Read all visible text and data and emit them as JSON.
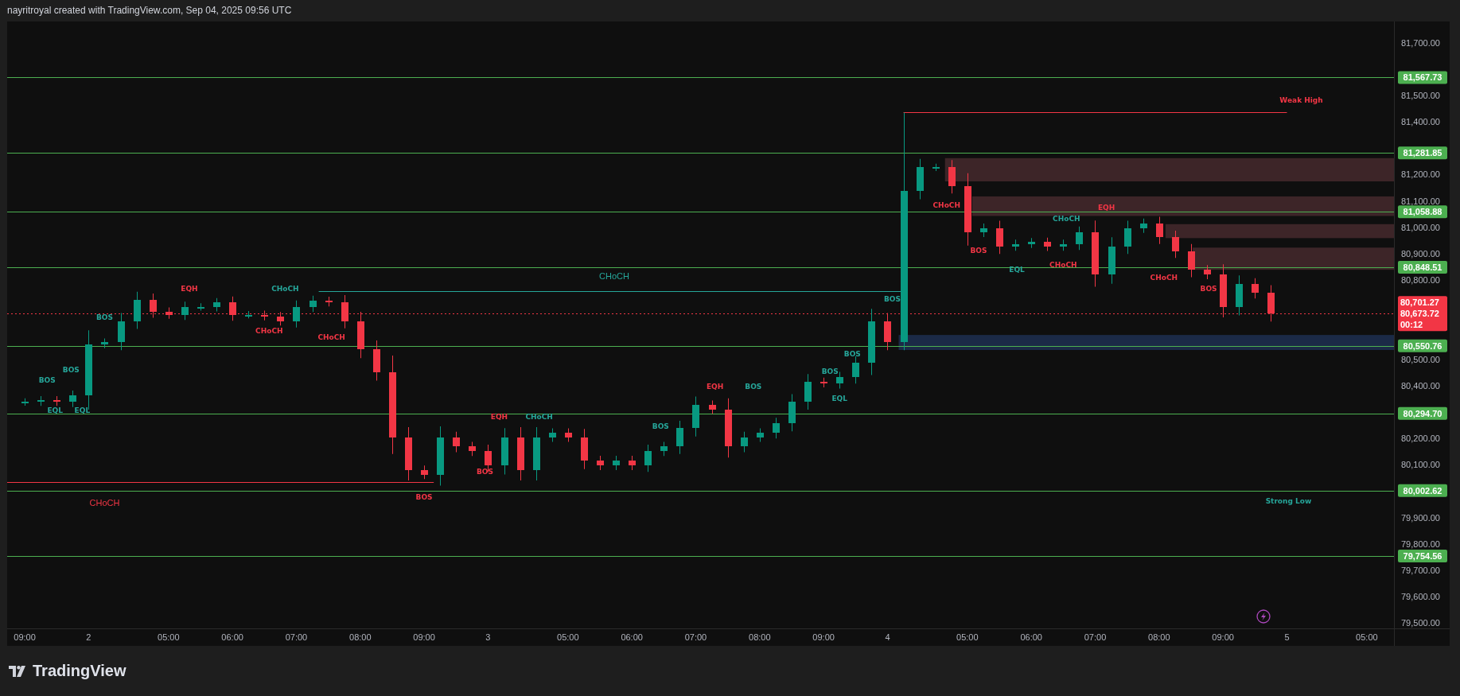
{
  "header": {
    "text": "nayritroyal created with TradingView.com, Sep 04, 2025 09:56 UTC"
  },
  "chart": {
    "chart_data": {
      "type": "candlestick",
      "categories": [
        "09:00",
        null,
        null,
        null,
        "2",
        null,
        null,
        null,
        null,
        "05:00",
        null,
        null,
        null,
        "06:00",
        null,
        null,
        null,
        "07:00",
        null,
        null,
        null,
        "08:00",
        null,
        null,
        null,
        "09:00",
        null,
        null,
        null,
        "3",
        null,
        null,
        null,
        null,
        "05:00",
        null,
        null,
        null,
        "06:00",
        null,
        null,
        null,
        "07:00",
        null,
        null,
        null,
        "08:00",
        null,
        null,
        null,
        "09:00",
        null,
        null,
        null,
        "4",
        null,
        null,
        null,
        null,
        "05:00",
        null,
        null,
        null,
        "06:00",
        null,
        null,
        null,
        "07:00",
        null,
        null,
        null,
        "08:00",
        null,
        null,
        null,
        "09:00",
        null,
        null,
        null,
        "5",
        null,
        null,
        null,
        null,
        "05:00"
      ],
      "ohlc": [
        [
          80338,
          80352,
          80324,
          80338
        ],
        [
          80338,
          80360,
          80323,
          80345
        ],
        [
          80345,
          80360,
          80323,
          80338
        ],
        [
          80338,
          80381,
          80319,
          80362
        ],
        [
          80362,
          80610,
          80309,
          80557
        ],
        [
          80557,
          80579,
          80542,
          80564
        ],
        [
          80564,
          80675,
          80534,
          80645
        ],
        [
          80645,
          80756,
          80615,
          80726
        ],
        [
          80726,
          80749,
          80657,
          80680
        ],
        [
          80680,
          80696,
          80653,
          80669
        ],
        [
          80669,
          80718,
          80649,
          80698
        ],
        [
          80698,
          80712,
          80684,
          80698
        ],
        [
          80698,
          80732,
          80681,
          80715
        ],
        [
          80715,
          80738,
          80646,
          80669
        ],
        [
          80669,
          80683,
          80655,
          80669
        ],
        [
          80669,
          80684,
          80647,
          80662
        ],
        [
          80662,
          80679,
          80628,
          80645
        ],
        [
          80645,
          80723,
          80620,
          80698
        ],
        [
          80698,
          80741,
          80679,
          80722
        ],
        [
          80722,
          80737,
          80700,
          80715
        ],
        [
          80715,
          80743,
          80617,
          80645
        ],
        [
          80645,
          80680,
          80504,
          80539
        ],
        [
          80539,
          80571,
          80419,
          80451
        ],
        [
          80451,
          80514,
          80141,
          80204
        ],
        [
          80204,
          80243,
          80041,
          80080
        ],
        [
          80080,
          80097,
          80046,
          80063
        ],
        [
          80063,
          80246,
          80021,
          80204
        ],
        [
          80204,
          80225,
          80148,
          80169
        ],
        [
          80169,
          80187,
          80133,
          80151
        ],
        [
          80151,
          80176,
          80073,
          80098
        ],
        [
          80098,
          80239,
          80063,
          80204
        ],
        [
          80204,
          80243,
          80041,
          80080
        ],
        [
          80080,
          80243,
          80041,
          80204
        ],
        [
          80204,
          80238,
          80187,
          80221
        ],
        [
          80221,
          80238,
          80187,
          80204
        ],
        [
          80204,
          80236,
          80084,
          80116
        ],
        [
          80116,
          80134,
          80080,
          80098
        ],
        [
          80098,
          80134,
          80080,
          80116
        ],
        [
          80116,
          80134,
          80080,
          80098
        ],
        [
          80098,
          80176,
          80073,
          80151
        ],
        [
          80151,
          80187,
          80133,
          80169
        ],
        [
          80169,
          80267,
          80141,
          80239
        ],
        [
          80239,
          80359,
          80207,
          80327
        ],
        [
          80327,
          80344,
          80293,
          80310
        ],
        [
          80310,
          80352,
          80127,
          80169
        ],
        [
          80169,
          80225,
          80148,
          80204
        ],
        [
          80204,
          80238,
          80187,
          80221
        ],
        [
          80221,
          80278,
          80200,
          80257
        ],
        [
          80257,
          80368,
          80227,
          80338
        ],
        [
          80338,
          80444,
          80309,
          80415
        ],
        [
          80415,
          80430,
          80393,
          80408
        ],
        [
          80408,
          80452,
          80389,
          80433
        ],
        [
          80433,
          80511,
          80408,
          80486
        ],
        [
          80486,
          80691,
          80440,
          80645
        ],
        [
          80645,
          80675,
          80534,
          80564
        ],
        [
          80564,
          81435,
          80534,
          81138
        ],
        [
          81138,
          81259,
          81106,
          81227
        ],
        [
          81227,
          81241,
          81213,
          81227
        ],
        [
          81227,
          81255,
          81128,
          81156
        ],
        [
          81156,
          81205,
          80931,
          80980
        ],
        [
          80980,
          81014,
          80963,
          80997
        ],
        [
          80997,
          81025,
          80899,
          80927
        ],
        [
          80927,
          80953,
          80911,
          80937
        ],
        [
          80937,
          80959,
          80922,
          80944
        ],
        [
          80944,
          80961,
          80910,
          80927
        ],
        [
          80927,
          80953,
          80911,
          80937
        ],
        [
          80937,
          81003,
          80914,
          80980
        ],
        [
          80980,
          81026,
          80775,
          80821
        ],
        [
          80821,
          80962,
          80786,
          80927
        ],
        [
          80927,
          81025,
          80899,
          80997
        ],
        [
          80997,
          81033,
          80979,
          81015
        ],
        [
          81015,
          81040,
          80937,
          80962
        ],
        [
          80962,
          80987,
          80884,
          80909
        ],
        [
          80909,
          80937,
          80811,
          80839
        ],
        [
          80839,
          80857,
          80803,
          80821
        ],
        [
          80821,
          80860,
          80659,
          80698
        ],
        [
          80698,
          80818,
          80666,
          80786
        ],
        [
          80786,
          80807,
          80730,
          80751
        ],
        [
          80751,
          80781,
          80643,
          80673
        ],
        null,
        null,
        null,
        null,
        null,
        null
      ],
      "ylim": [
        79480,
        81780
      ],
      "yticks": [
        {
          "value": 81700,
          "label": "81,700.00"
        },
        {
          "value": 81500,
          "label": "81,500.00"
        },
        {
          "value": 81400,
          "label": "81,400.00"
        },
        {
          "value": 81200,
          "label": "81,200.00"
        },
        {
          "value": 81100,
          "label": "81,100.00"
        },
        {
          "value": 81000,
          "label": "81,000.00"
        },
        {
          "value": 80900,
          "label": "80,900.00"
        },
        {
          "value": 80800,
          "label": "80,800.00"
        },
        {
          "value": 80500,
          "label": "80,500.00"
        },
        {
          "value": 80400,
          "label": "80,400.00"
        },
        {
          "value": 80200,
          "label": "80,200.00"
        },
        {
          "value": 80100,
          "label": "80,100.00"
        },
        {
          "value": 79900,
          "label": "79,900.00"
        },
        {
          "value": 79800,
          "label": "79,800.00"
        },
        {
          "value": 79700,
          "label": "79,700.00"
        },
        {
          "value": 79600,
          "label": "79,600.00"
        },
        {
          "value": 79500,
          "label": "79,500.00"
        }
      ],
      "ref_lines": [
        {
          "axis": "y",
          "value": 81567.73,
          "label": "81,567.73"
        },
        {
          "axis": "y",
          "value": 81281.85,
          "label": "81,281.85"
        },
        {
          "axis": "y",
          "value": 81058.88,
          "label": "81,058.88"
        },
        {
          "axis": "y",
          "value": 80848.51,
          "label": "80,848.51"
        },
        {
          "axis": "y",
          "value": 80550.76,
          "label": "80,550.76"
        },
        {
          "axis": "y",
          "value": 80294.7,
          "label": "80,294.70"
        },
        {
          "axis": "y",
          "value": 80002.62,
          "label": "80,002.62"
        },
        {
          "axis": "y",
          "value": 79754.56,
          "label": "79,754.56"
        },
        {
          "axis": "y",
          "value": 81435
        },
        {
          "axis": "y",
          "value": 80034
        },
        {
          "axis": "y",
          "value": 80757
        },
        {
          "axis": "y",
          "value": 80673.72
        }
      ],
      "bands": [
        {
          "axis": "y",
          "from": 81174,
          "to": 81262
        },
        {
          "axis": "y",
          "from": 81043,
          "to": 81117
        },
        {
          "axis": "y",
          "from": 80959,
          "to": 81012
        },
        {
          "axis": "y",
          "from": 80839,
          "to": 80923
        },
        {
          "axis": "y",
          "from": 80535,
          "to": 80592
        }
      ]
    },
    "ref_line_styles": [
      {
        "color": "#4caf50"
      },
      {
        "color": "#4caf50"
      },
      {
        "color": "#4caf50"
      },
      {
        "color": "#4caf50"
      },
      {
        "color": "#4caf50"
      },
      {
        "color": "#4caf50"
      },
      {
        "color": "#4caf50"
      },
      {
        "color": "#4caf50"
      },
      {
        "color": "#f23645"
      },
      {
        "color": "#f23645"
      },
      {
        "color": "#26a69a"
      },
      {
        "color": "#f23645",
        "kind": "dotted"
      }
    ],
    "band_styles": [
      {
        "color": "#3d2528"
      },
      {
        "color": "#3d2528"
      },
      {
        "color": "#3d2528"
      },
      {
        "color": "#3d2528"
      },
      {
        "color": "#1b2a47"
      }
    ],
    "structure_labels": [
      {
        "text": "BOS",
        "color": "#26a69a"
      },
      {
        "text": "EQL",
        "color": "#26a69a"
      },
      {
        "text": "BOS",
        "color": "#26a69a"
      },
      {
        "text": "EQL",
        "color": "#26a69a"
      },
      {
        "text": "BOS",
        "color": "#26a69a"
      },
      {
        "text": "EQH",
        "color": "#f23645"
      },
      {
        "text": "CHoCH",
        "color": "#26a69a"
      },
      {
        "text": "CHoCH",
        "color": "#f23645"
      },
      {
        "text": "CHoCH",
        "color": "#f23645"
      },
      {
        "text": "BOS",
        "color": "#f23645"
      },
      {
        "text": "CHoCH",
        "color": "#f23645",
        "kind": "major"
      },
      {
        "text": "EQH",
        "color": "#f23645"
      },
      {
        "text": "BOS",
        "color": "#f23645"
      },
      {
        "text": "CHoCH",
        "color": "#26a69a"
      },
      {
        "text": "BOS",
        "color": "#26a69a"
      },
      {
        "text": "EQH",
        "color": "#f23645"
      },
      {
        "text": "BOS",
        "color": "#26a69a"
      },
      {
        "text": "BOS",
        "color": "#26a69a"
      },
      {
        "text": "EQL",
        "color": "#26a69a"
      },
      {
        "text": "BOS",
        "color": "#26a69a"
      },
      {
        "text": "BOS",
        "color": "#26a69a"
      },
      {
        "text": "CHoCH",
        "color": "#26a69a",
        "kind": "major"
      },
      {
        "text": "CHoCH",
        "color": "#f23645"
      },
      {
        "text": "BOS",
        "color": "#f23645"
      },
      {
        "text": "EQL",
        "color": "#26a69a"
      },
      {
        "text": "CHoCH",
        "color": "#26a69a"
      },
      {
        "text": "EQH",
        "color": "#f23645"
      },
      {
        "text": "CHoCH",
        "color": "#f23645"
      },
      {
        "text": "CHoCH",
        "color": "#f23645"
      },
      {
        "text": "BOS",
        "color": "#f23645"
      },
      {
        "text": "Weak High",
        "color": "#f23645"
      },
      {
        "text": "Strong Low",
        "color": "#26a69a"
      }
    ],
    "price_tag": {
      "labels": [
        "80,701.27",
        "80,673.72",
        "00:12"
      ]
    }
  },
  "footer": {
    "brand": "TradingView"
  }
}
